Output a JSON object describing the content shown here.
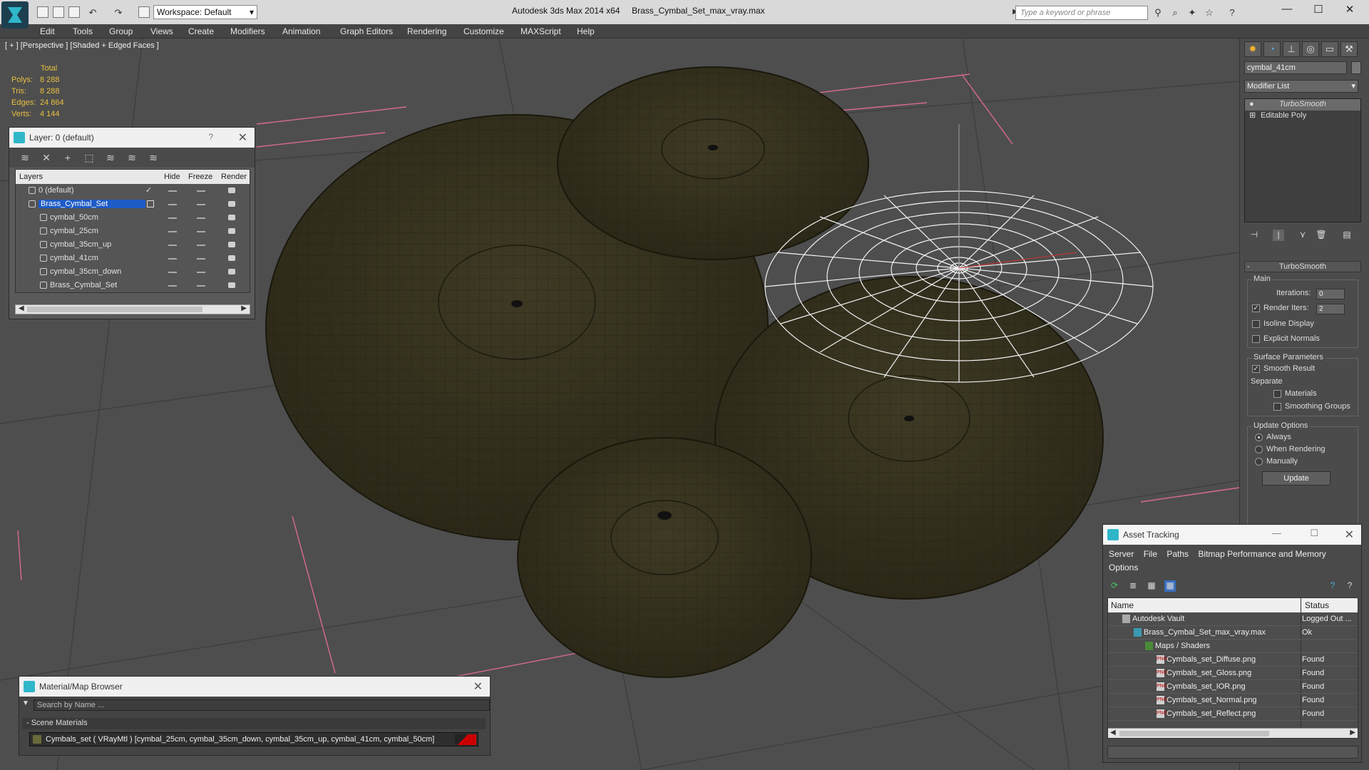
{
  "titlebar": {
    "workspace": "Workspace: Default",
    "app_name": "Autodesk 3ds Max  2014 x64",
    "file_name": "Brass_Cymbal_Set_max_vray.max",
    "search_placeholder": "Type a keyword or phrase"
  },
  "menu": [
    "Edit",
    "Tools",
    "Group",
    "Views",
    "Create",
    "Modifiers",
    "Animation",
    "Graph Editors",
    "Rendering",
    "Customize",
    "MAXScript",
    "Help"
  ],
  "viewport": {
    "label": "[ + ] [Perspective ] [Shaded + Edged Faces ]",
    "stats": {
      "header": "Total",
      "rows": [
        {
          "label": "Polys:",
          "value": "8 288"
        },
        {
          "label": "Tris:",
          "value": "8 288"
        },
        {
          "label": "Edges:",
          "value": "24 864"
        },
        {
          "label": "Verts:",
          "value": "4 144"
        }
      ]
    }
  },
  "layer_window": {
    "title": "Layer: 0 (default)",
    "help": "?",
    "columns": {
      "layers": "Layers",
      "hide": "Hide",
      "freeze": "Freeze",
      "render": "Render"
    },
    "rows": [
      {
        "name": "0 (default)"
      },
      {
        "name": "Brass_Cymbal_Set"
      },
      {
        "name": "cymbal_50cm"
      },
      {
        "name": "cymbal_25cm"
      },
      {
        "name": "cymbal_35cm_up"
      },
      {
        "name": "cymbal_41cm"
      },
      {
        "name": "cymbal_35cm_down"
      },
      {
        "name": "Brass_Cymbal_Set"
      }
    ]
  },
  "command_panel": {
    "object_name": "cymbal_41cm",
    "modifier_list": "Modifier List",
    "stack": [
      "TurboSmooth",
      "Editable Poly"
    ],
    "rollout_title": "TurboSmooth",
    "main_label": "Main",
    "iterations_label": "Iterations:",
    "iterations_value": "0",
    "render_iters_label": "Render Iters:",
    "render_iters_value": "2",
    "isoline_label": "Isoline Display",
    "explicit_label": "Explicit Normals",
    "surface_label": "Surface Parameters",
    "smooth_result_label": "Smooth Result",
    "separate_label": "Separate",
    "materials_label": "Materials",
    "smoothing_groups_label": "Smoothing Groups",
    "update_options_label": "Update Options",
    "always_label": "Always",
    "when_rendering_label": "When Rendering",
    "manually_label": "Manually",
    "update_button": "Update"
  },
  "material_browser": {
    "title": "Material/Map Browser",
    "search_placeholder": "Search by Name ...",
    "group": "- Scene Materials",
    "item": "Cymbals_set  ( VRayMtl )  [cymbal_25cm, cymbal_35cm_down, cymbal_35cm_up, cymbal_41cm, cymbal_50cm]"
  },
  "asset_tracking": {
    "title": "Asset Tracking",
    "menu": [
      "Server",
      "File",
      "Paths",
      "Bitmap Performance and Memory",
      "Options"
    ],
    "columns": {
      "name": "Name",
      "status": "Status"
    },
    "rows": [
      {
        "name": "Autodesk Vault",
        "status": "Logged Out ..."
      },
      {
        "name": "Brass_Cymbal_Set_max_vray.max",
        "status": "Ok"
      },
      {
        "name": "Maps / Shaders",
        "status": ""
      },
      {
        "name": "Cymbals_set_Diffuse.png",
        "status": "Found"
      },
      {
        "name": "Cymbals_set_Gloss.png",
        "status": "Found"
      },
      {
        "name": "Cymbals_set_IOR.png",
        "status": "Found"
      },
      {
        "name": "Cymbals_set_Normal.png",
        "status": "Found"
      },
      {
        "name": "Cymbals_set_Reflect.png",
        "status": "Found"
      }
    ]
  }
}
